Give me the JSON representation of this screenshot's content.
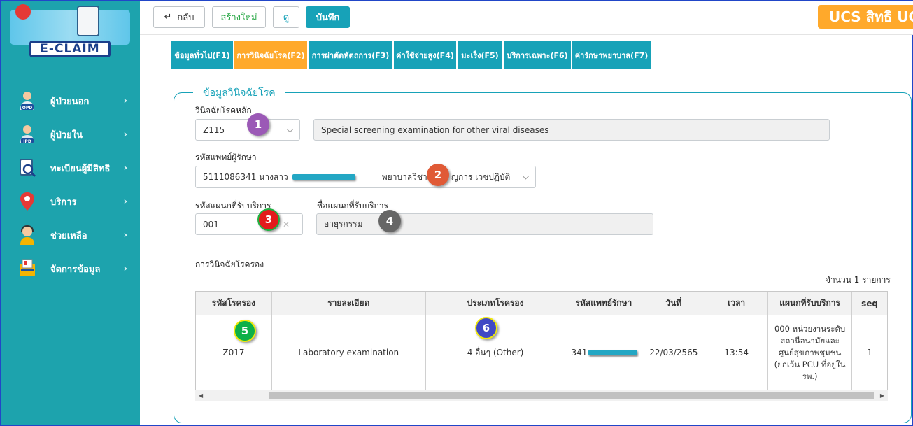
{
  "sidebar": {
    "logo_text": "E-CLAIM",
    "items": [
      {
        "label": "ผู้ป่วยนอก",
        "icon": "opd-doctor-icon",
        "badge": "OPD"
      },
      {
        "label": "ผู้ป่วยใน",
        "icon": "ipd-patient-icon",
        "badge": "IPD"
      },
      {
        "label": "ทะเบียนผู้มีสิทธิ",
        "icon": "registry-search-icon"
      },
      {
        "label": "บริการ",
        "icon": "location-pin-icon"
      },
      {
        "label": "ช่วยเหลือ",
        "icon": "support-agent-icon"
      },
      {
        "label": "จัดการข้อมูล",
        "icon": "data-management-icon"
      }
    ]
  },
  "toolbar": {
    "back_label": "กลับ",
    "new_label": "สร้างใหม่",
    "view_label": "ดู",
    "save_label": "บันทึก",
    "ucs_label": "UCS สิทธิ UC"
  },
  "tabs": [
    {
      "label": "ข้อมูลทั่วไป(F1)",
      "active": false
    },
    {
      "label": "การวินิจฉัยโรค(F2)",
      "active": true
    },
    {
      "label": "การผ่าตัดหัตถการ(F3)",
      "active": false
    },
    {
      "label": "ค่าใช้จ่ายสูง(F4)",
      "active": false
    },
    {
      "label": "มะเร็ง(F5)",
      "active": false
    },
    {
      "label": "บริการเฉพาะ(F6)",
      "active": false
    },
    {
      "label": "ค่ารักษาพยาบาล(F7)",
      "active": false
    }
  ],
  "diagnosis": {
    "section_title": "ข้อมูลวินิจฉัยโรค",
    "main_dx_label": "วินิจฉัยโรคหลัก",
    "main_dx_code": "Z115",
    "main_dx_desc": "Special screening examination for other viral diseases",
    "doctor_label": "รหัสแพทย์ผู้รักษา",
    "doctor_prefix": "5111086341 นางสาว",
    "doctor_suffix": "พยาบาลวิชา",
    "doctor_tail": "ญการ เวชปฏิบัติ",
    "dept_code_label": "รหัสแผนกที่รับบริการ",
    "dept_code": "001",
    "dept_name_label": "ชื่อแผนกที่รับบริการ",
    "dept_name": "อายุรกรรม",
    "secondary_label": "การวินิจฉัยโรครอง",
    "count_text": "จำนวน 1 รายการ"
  },
  "badges": [
    "1",
    "2",
    "3",
    "4",
    "5",
    "6"
  ],
  "colors": {
    "accent": "#17a2b8",
    "active_tab": "#ffa92b",
    "sidebar": "#1da3ad"
  },
  "table": {
    "headers": [
      "รหัสโรครอง",
      "รายละเอียด",
      "ประเภทโรครอง",
      "รหัสแพทย์รักษา",
      "วันที่",
      "เวลา",
      "แผนกที่รับบริการ",
      "seq"
    ],
    "rows": [
      [
        "Z017",
        "Laboratory examination",
        "4 อื่นๆ (Other)",
        "341",
        "22/03/2565",
        "13:54",
        "000 หน่วยงานระดับสถานีอนามัยและศูนย์สุขภาพชุมชน (ยกเว้น PCU ที่อยู่ใน รพ.)",
        "1"
      ]
    ]
  }
}
